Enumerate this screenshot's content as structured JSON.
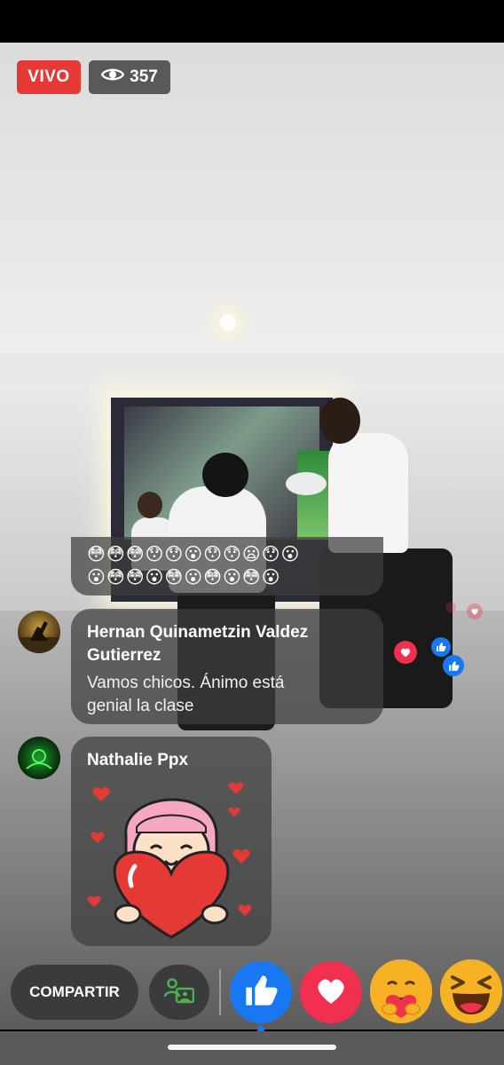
{
  "live": {
    "live_label": "VIVO",
    "viewer_count": "357",
    "eye_icon": "eye-icon"
  },
  "comments": [
    {
      "type": "emoji",
      "row1": "😳😳😳😯😯😮😯😯😦😯😮",
      "row2": "😮😳😳😮😳😮😳😮😳😮"
    },
    {
      "name_line1": "Hernan Quinametzin Valdez",
      "name_line2": "Gutierrez",
      "text_line1": "Vamos chicos. Ánimo está",
      "text_line2": "genial la clase"
    },
    {
      "name": "Nathalie Ppx",
      "sticker": "heart-girl-sticker"
    }
  ],
  "bottom_bar": {
    "share_label": "COMPARTIR",
    "pip_icon": "picture-in-picture-icon",
    "reactions": [
      "like",
      "love",
      "care",
      "haha"
    ]
  },
  "colors": {
    "live_red": "#e53935",
    "like_blue": "#1877f2",
    "love_red": "#f0304e",
    "emoji_yellow": "#f7b125"
  }
}
